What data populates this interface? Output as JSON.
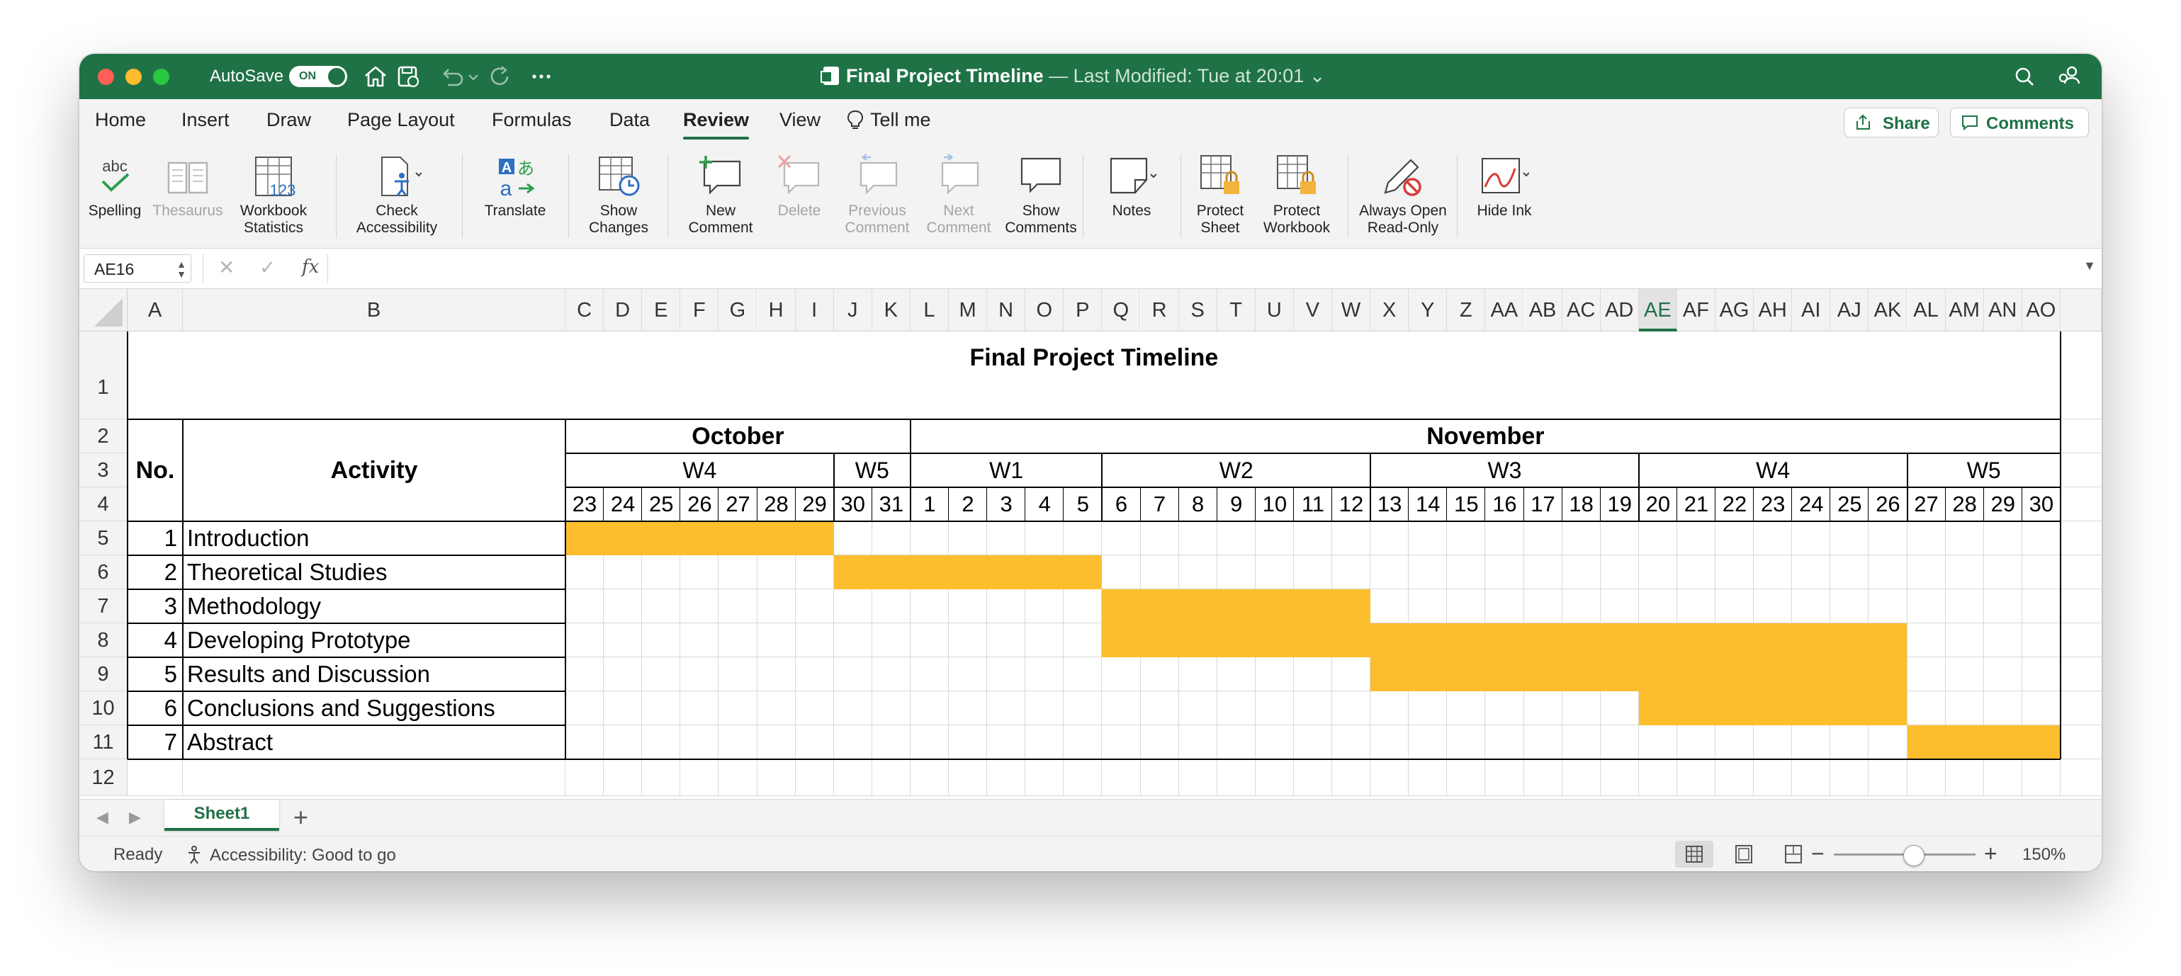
{
  "app": {
    "autosave_label": "AutoSave",
    "autosave_state": "ON",
    "file_name": "Final Project Timeline",
    "last_modified": "— Last Modified: Tue at 20:01",
    "accent_color": "#1f7246"
  },
  "tabs": [
    "Home",
    "Insert",
    "Draw",
    "Page Layout",
    "Formulas",
    "Data",
    "Review",
    "View",
    "Tell me"
  ],
  "active_tab": "Review",
  "share_label": "Share",
  "comments_label": "Comments",
  "ribbon": {
    "spelling": "Spelling",
    "thesaurus": "Thesaurus",
    "workbook_stats_1": "Workbook",
    "workbook_stats_2": "Statistics",
    "check_acc_1": "Check",
    "check_acc_2": "Accessibility",
    "translate": "Translate",
    "show_changes_1": "Show",
    "show_changes_2": "Changes",
    "new_comment_1": "New",
    "new_comment_2": "Comment",
    "delete": "Delete",
    "prev_comment_1": "Previous",
    "prev_comment_2": "Comment",
    "next_comment_1": "Next",
    "next_comment_2": "Comment",
    "show_comments_1": "Show",
    "show_comments_2": "Comments",
    "notes": "Notes",
    "protect_sheet_1": "Protect",
    "protect_sheet_2": "Sheet",
    "protect_workbook_1": "Protect",
    "protect_workbook_2": "Workbook",
    "always_open_1": "Always Open",
    "always_open_2": "Read-Only",
    "hide_ink": "Hide Ink"
  },
  "formula_bar": {
    "name_box": "AE16",
    "fx": "fx",
    "content": ""
  },
  "columns": [
    "A",
    "B",
    "C",
    "D",
    "E",
    "F",
    "G",
    "H",
    "I",
    "J",
    "K",
    "L",
    "M",
    "N",
    "O",
    "P",
    "Q",
    "R",
    "S",
    "T",
    "U",
    "V",
    "W",
    "X",
    "Y",
    "Z",
    "AA",
    "AB",
    "AC",
    "AD",
    "AE",
    "AF",
    "AG",
    "AH",
    "AI",
    "AJ",
    "AK",
    "AL",
    "AM",
    "AN",
    "AO"
  ],
  "selected_column": "AE",
  "rows": [
    "1",
    "2",
    "3",
    "4",
    "5",
    "6",
    "7",
    "8",
    "9",
    "10",
    "11",
    "12"
  ],
  "sheet": {
    "title": "Final Project Timeline",
    "header_no": "No.",
    "header_activity": "Activity",
    "months": [
      "October",
      "November"
    ],
    "weeks": [
      "W4",
      "W5",
      "W1",
      "W2",
      "W3",
      "W4",
      "W5"
    ],
    "days": [
      "23",
      "24",
      "25",
      "26",
      "27",
      "28",
      "29",
      "30",
      "31",
      "1",
      "2",
      "3",
      "4",
      "5",
      "6",
      "7",
      "8",
      "9",
      "10",
      "11",
      "12",
      "13",
      "14",
      "15",
      "16",
      "17",
      "18",
      "19",
      "20",
      "21",
      "22",
      "23",
      "24",
      "25",
      "26",
      "27",
      "28",
      "29",
      "30"
    ],
    "activities": [
      {
        "no": "1",
        "name": "Introduction"
      },
      {
        "no": "2",
        "name": "Theoretical Studies"
      },
      {
        "no": "3",
        "name": "Methodology"
      },
      {
        "no": "4",
        "name": "Developing Prototype"
      },
      {
        "no": "5",
        "name": "Results and Discussion"
      },
      {
        "no": "6",
        "name": "Conclusions and Suggestions"
      },
      {
        "no": "7",
        "name": "Abstract"
      }
    ],
    "schedule": [
      {
        "from_day": "Oct 23",
        "to_day": "Oct 29"
      },
      {
        "from_day": "Oct 30",
        "to_day": "Nov 5"
      },
      {
        "from_day": "Nov 6",
        "to_day": "Nov 12"
      },
      {
        "from_day": "Nov 6",
        "to_day": "Nov 26"
      },
      {
        "from_day": "Nov 13",
        "to_day": "Nov 26"
      },
      {
        "from_day": "Nov 20",
        "to_day": "Nov 26"
      },
      {
        "from_day": "Nov 27",
        "to_day": "Nov 30"
      }
    ],
    "bar_color": "#fcbe2c"
  },
  "sheet_tabs": [
    "Sheet1"
  ],
  "status": {
    "ready": "Ready",
    "accessibility": "Accessibility: Good to go",
    "zoom": "150%"
  }
}
